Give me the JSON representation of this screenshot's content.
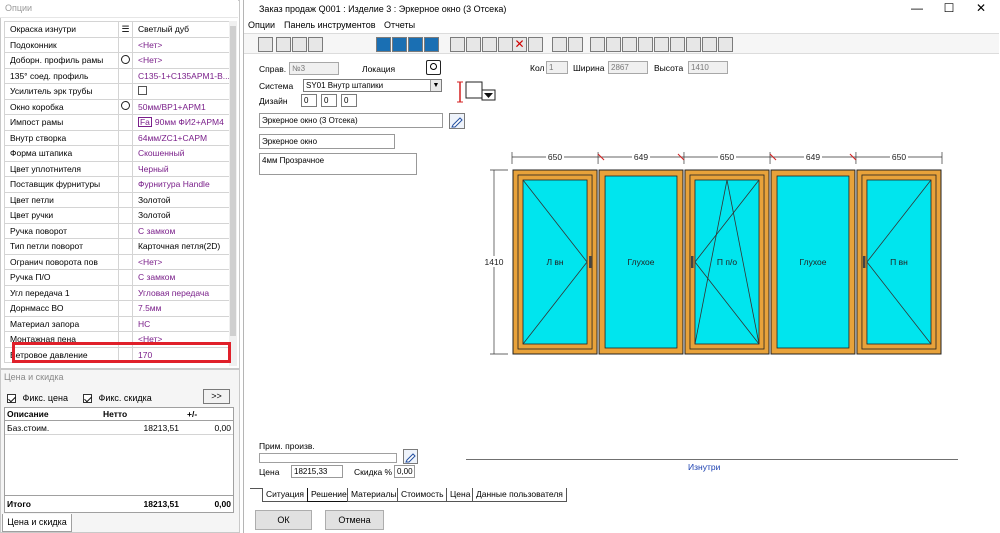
{
  "options_panel": {
    "title": "Опции",
    "rows": [
      {
        "label": "Окраска изнутри",
        "icon": "filter",
        "value": "Светлый дуб",
        "value_color": "black"
      },
      {
        "label": "Подоконник",
        "icon": "",
        "value": "<Нет>",
        "value_color": "purple"
      },
      {
        "label": "Доборн. профиль рамы",
        "icon": "gear",
        "value": "<Нет>",
        "value_color": "purple"
      },
      {
        "label": "135° соед. профиль",
        "icon": "",
        "value": "C135-1+C135APM1-B...",
        "value_color": "purple"
      },
      {
        "label": "Усилитель эрк трубы",
        "icon": "",
        "value": "",
        "value_color": "checkbox"
      },
      {
        "label": "Окно коробка",
        "icon": "gear",
        "value": "50мм/BP1+APM1",
        "value_color": "purple"
      },
      {
        "label": "Импост рамы",
        "icon": "",
        "value": "90мм  ФИ2+APM4",
        "value_color": "purple",
        "prefix": "Fa"
      },
      {
        "label": "Внутр створка",
        "icon": "",
        "value": "64мм/ZC1+CAPM",
        "value_color": "purple"
      },
      {
        "label": "Форма штапика",
        "icon": "",
        "value": "Скошенный",
        "value_color": "purple"
      },
      {
        "label": "Цвет уплотнителя",
        "icon": "",
        "value": "Черный",
        "value_color": "purple"
      },
      {
        "label": "Поставщик фурнитуры",
        "icon": "",
        "value": "Фурнитура Handle",
        "value_color": "purple"
      },
      {
        "label": "Цвет петли",
        "icon": "",
        "value": "Золотой",
        "value_color": "black"
      },
      {
        "label": "Цвет ручки",
        "icon": "",
        "value": "Золотой",
        "value_color": "black"
      },
      {
        "label": "Ручка поворот",
        "icon": "",
        "value": "С замком",
        "value_color": "purple"
      },
      {
        "label": "Тип петли поворот",
        "icon": "",
        "value": "Карточная петля(2D)",
        "value_color": "black"
      },
      {
        "label": "Огранич поворота пов",
        "icon": "",
        "value": "<Нет>",
        "value_color": "purple"
      },
      {
        "label": "Ручка П/О",
        "icon": "",
        "value": "С замком",
        "value_color": "purple"
      },
      {
        "label": "Угл передача 1",
        "icon": "",
        "value": "Угловая передача",
        "value_color": "purple"
      },
      {
        "label": "Дорнмасс ВО",
        "icon": "",
        "value": "7.5мм",
        "value_color": "purple"
      },
      {
        "label": "Материал запора",
        "icon": "",
        "value": "НС",
        "value_color": "purple"
      },
      {
        "label": "Монтажная пена",
        "icon": "",
        "value": "<Нет>",
        "value_color": "purple"
      },
      {
        "label": "Ветровое давление",
        "icon": "",
        "value": "170",
        "value_color": "purple"
      }
    ]
  },
  "price_panel": {
    "title": "Цена и скидка",
    "fix_price_label": "Фикс. цена",
    "fix_discount_label": "Фикс. скидка",
    "more_label": ">>",
    "columns": {
      "description": "Описание",
      "net": "Нетто",
      "plusminus": "+/-"
    },
    "row": {
      "description": "Баз.стоим.",
      "net": "18213,51",
      "plusminus": "0,00"
    },
    "total": {
      "label": "Итого",
      "net": "18213,51",
      "plusminus": "0,00"
    },
    "tab_label": "Цена и скидка"
  },
  "main_window": {
    "title": "Заказ продаж Q001    : Изделие 3 : Эркерное окно (3 Отсека)",
    "controls": {
      "minimize": "—",
      "maximize": "☐",
      "close": "✕"
    },
    "menu": [
      "Опции",
      "Панель инструментов",
      "Отчеты"
    ],
    "form": {
      "sprav_label": "Справ.",
      "sprav_value": "№3",
      "location_label": "Локация",
      "kol_label": "Кол",
      "kol_value": "1",
      "width_label": "Ширина",
      "width_value": "2867",
      "height_label": "Высота",
      "height_value": "1410",
      "system_label": "Система",
      "system_value": "SY01  Внутр штапики",
      "design_label": "Дизайн",
      "design_values": [
        "0",
        "0",
        "0"
      ],
      "name_value": "Эркерное окно (3 Отсека)",
      "type_value": "Эркерное окно",
      "glass_value": "4мм Прозрачное",
      "mfg_note_label": "Прим. произв.",
      "price_label": "Цена",
      "price_value": "18215,33",
      "discount_label": "Скидка %",
      "discount_value": "0,00",
      "inside_label": "Изнутри"
    },
    "drawing": {
      "widths": [
        "650",
        "649",
        "650",
        "649",
        "650"
      ],
      "height": "1410",
      "panes": [
        "Л вн",
        "Глухое",
        "П п/о",
        "Глухое",
        "П вн"
      ],
      "colors": {
        "frame": "#e8a23a",
        "glass": "#00e5ee",
        "stroke": "#222222",
        "accent": "#d42020"
      }
    },
    "tabs": [
      "Ситуация",
      "Решение",
      "Материалы",
      "Стоимость",
      "Цена",
      "Данные пользователя"
    ],
    "ok_label": "ОК",
    "cancel_label": "Отмена"
  }
}
